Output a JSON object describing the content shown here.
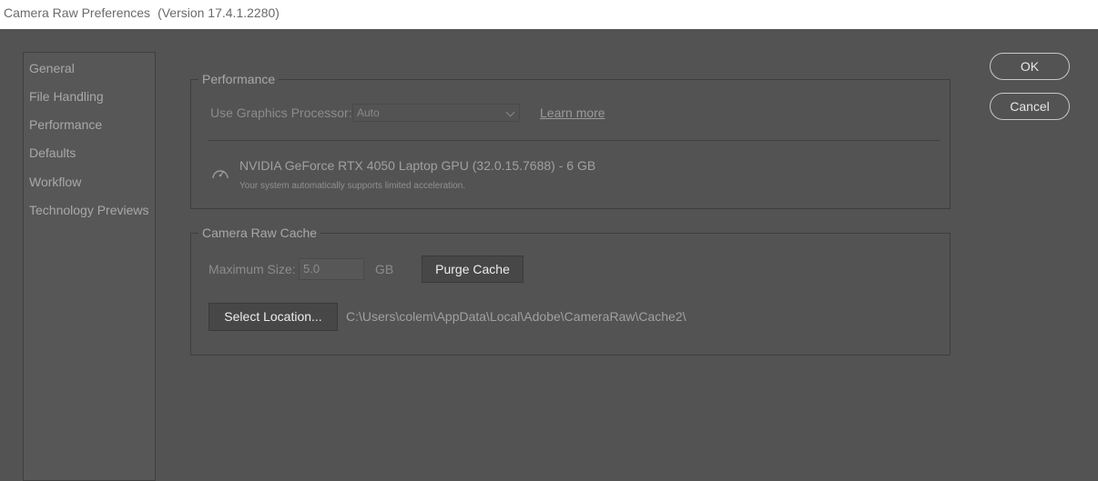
{
  "window": {
    "title": "Camera Raw Preferences",
    "version": "(Version 17.4.1.2280)"
  },
  "sidebar": {
    "items": [
      {
        "label": "General"
      },
      {
        "label": "File Handling"
      },
      {
        "label": "Performance"
      },
      {
        "label": "Defaults"
      },
      {
        "label": "Workflow"
      },
      {
        "label": "Technology Previews"
      }
    ]
  },
  "performance": {
    "legend": "Performance",
    "gpu_label": "Use Graphics Processor:",
    "gpu_value": "Auto",
    "learn_more": "Learn more",
    "gpu_icon": "gauge-icon",
    "gpu_name": "NVIDIA GeForce RTX 4050 Laptop GPU (32.0.15.7688) - 6 GB",
    "gpu_note": "Your system automatically supports limited acceleration."
  },
  "cache": {
    "legend": "Camera Raw Cache",
    "max_size_label": "Maximum Size:",
    "max_size_value": "5.0",
    "unit": "GB",
    "purge_label": "Purge Cache",
    "select_location_label": "Select Location...",
    "path": "C:\\Users\\colem\\AppData\\Local\\Adobe\\CameraRaw\\Cache2\\"
  },
  "actions": {
    "ok_label": "OK",
    "cancel_label": "Cancel"
  }
}
